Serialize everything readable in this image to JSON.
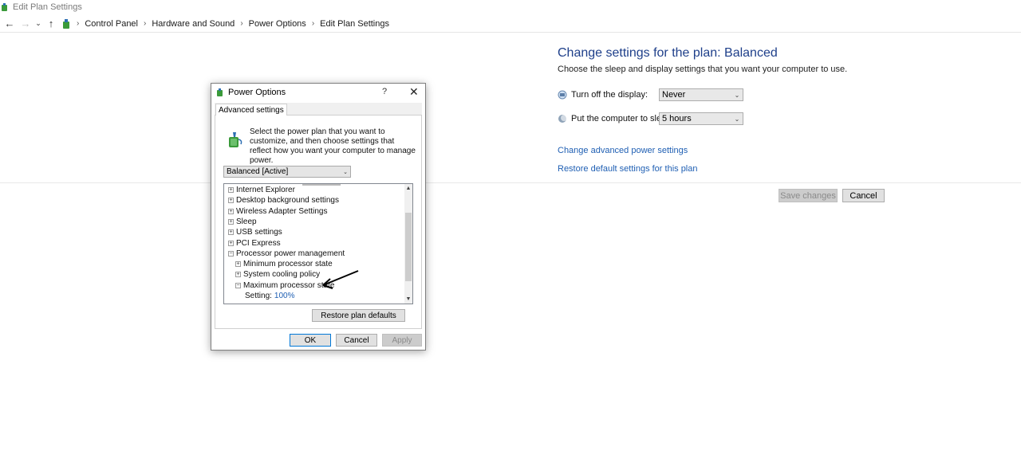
{
  "window": {
    "title": "Edit Plan Settings"
  },
  "address_bar": {
    "back_icon": "arrow-left-icon",
    "forward_icon": "arrow-right-icon",
    "recent_icon": "chevron-down-icon",
    "up_icon": "arrow-up-icon",
    "breadcrumbs": [
      "Control Panel",
      "Hardware and Sound",
      "Power Options",
      "Edit Plan Settings"
    ]
  },
  "plan": {
    "title": "Change settings for the plan: Balanced",
    "subtitle": "Choose the sleep and display settings that you want your computer to use.",
    "display": {
      "label": "Turn off the display:",
      "value": "Never"
    },
    "sleep": {
      "label": "Put the computer to sleep:",
      "value": "5 hours"
    },
    "advanced_link": "Change advanced power settings",
    "restore_link": "Restore default settings for this plan",
    "save_label": "Save changes",
    "cancel_label": "Cancel"
  },
  "dialog": {
    "title": "Power Options",
    "help": "?",
    "tab": "Advanced settings",
    "intro": "Select the power plan that you want to customize, and then choose settings that reflect how you want your computer to manage power.",
    "plan_selected": "Balanced [Active]",
    "tree": [
      {
        "label": "Internet Explorer",
        "level": 0,
        "toggle": "+"
      },
      {
        "label": "Desktop background settings",
        "level": 0,
        "toggle": "+"
      },
      {
        "label": "Wireless Adapter Settings",
        "level": 0,
        "toggle": "+"
      },
      {
        "label": "Sleep",
        "level": 0,
        "toggle": "+"
      },
      {
        "label": "USB settings",
        "level": 0,
        "toggle": "+"
      },
      {
        "label": "PCI Express",
        "level": 0,
        "toggle": "+"
      },
      {
        "label": "Processor power management",
        "level": 0,
        "toggle": "−"
      },
      {
        "label": "Minimum processor state",
        "level": 1,
        "toggle": "+"
      },
      {
        "label": "System cooling policy",
        "level": 1,
        "toggle": "+"
      },
      {
        "label": "Maximum processor state",
        "level": 1,
        "toggle": "−"
      },
      {
        "label": "Setting:",
        "level": 2,
        "toggle": "",
        "value": "100%"
      }
    ],
    "restore_defaults_label": "Restore plan defaults",
    "ok_label": "OK",
    "cancel_label": "Cancel",
    "apply_label": "Apply"
  },
  "colors": {
    "link": "#1f5fb3",
    "heading": "#1e3f8a",
    "focus_border": "#0078d7"
  }
}
